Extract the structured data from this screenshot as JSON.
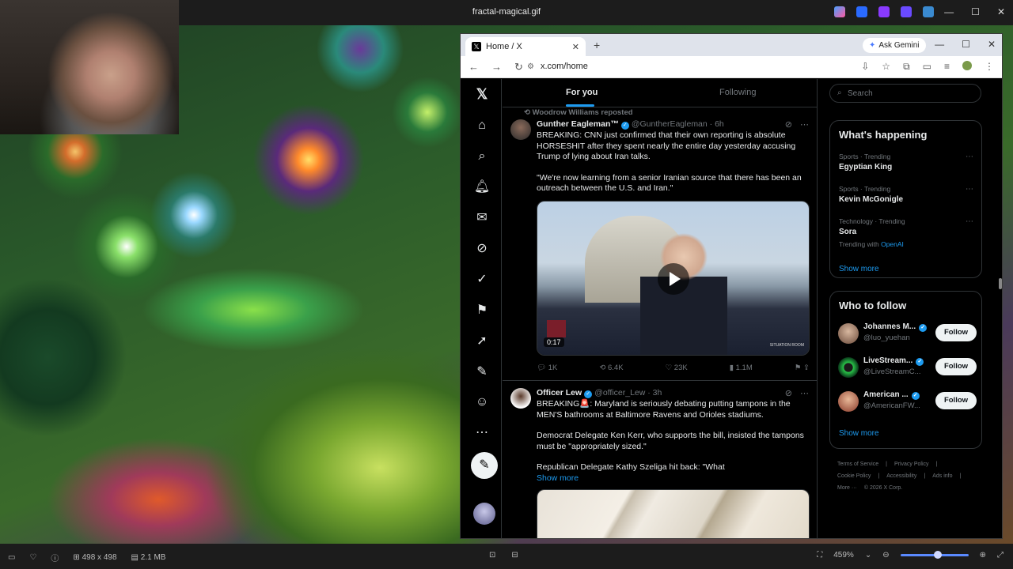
{
  "viewer": {
    "title": "fractal-magical.gif",
    "window_controls": [
      "—",
      "☐",
      "✕"
    ],
    "status": {
      "dimensions": "498 x 498",
      "size": "2.1 MB",
      "zoom": "459%"
    }
  },
  "browser": {
    "tab_title": "Home / X",
    "tab_close": "✕",
    "new_tab": "+",
    "gemini_label": "Ask Gemini",
    "url": "x.com/home",
    "window_controls": [
      "—",
      "☐",
      "✕"
    ]
  },
  "x": {
    "tabs": {
      "for_you": "For you",
      "following": "Following"
    },
    "posts": [
      {
        "repost_by": "Woodrow Williams reposted",
        "name": "Gunther Eagleman™",
        "handle": "@GuntherEagleman · 6h",
        "text": [
          "BREAKING: CNN just confirmed that their own reporting is absolute HORSESHIT after they spent nearly the entire day yesterday accusing Trump of lying about Iran talks.",
          "\"We're now learning from a senior Iranian source that there has been an outreach between the U.S. and Iran.\""
        ],
        "video_duration": "0:17",
        "video_caption": "SITUATION ROOM",
        "replies": "1K",
        "reposts": "6.4K",
        "likes": "23K",
        "views": "1.1M"
      },
      {
        "name": "Officer Lew",
        "handle": "@officer_Lew · 3h",
        "text": [
          "BREAKING🚨: Maryland is seriously debating putting tampons in the MEN'S bathrooms at Baltimore Ravens and Orioles stadiums.",
          "Democrat Delegate Ken Kerr, who supports the bill, insisted the tampons must be \"appropriately sized.\"",
          "Republican Delegate Kathy Szeliga hit back: \"What"
        ],
        "show_more": "Show more"
      }
    ],
    "search_placeholder": "Search",
    "happening": {
      "title": "What's happening",
      "trends": [
        {
          "meta": "Sports · Trending",
          "topic": "Egyptian King"
        },
        {
          "meta": "Sports · Trending",
          "topic": "Kevin McGonigle"
        },
        {
          "meta": "Technology · Trending",
          "topic": "Sora",
          "sub": "Trending with",
          "sub_link": "OpenAI"
        }
      ],
      "show_more": "Show more"
    },
    "who_to_follow": {
      "title": "Who to follow",
      "accounts": [
        {
          "name": "Johannes M...",
          "handle": "@luo_yuehan",
          "button": "Follow"
        },
        {
          "name": "LiveStream...",
          "handle": "@LiveStreamC...",
          "button": "Follow"
        },
        {
          "name": "American ...",
          "handle": "@AmericanFW...",
          "button": "Follow"
        }
      ],
      "show_more": "Show more"
    },
    "legal": [
      "Terms of Service",
      "|",
      "Privacy Policy",
      "|",
      "Cookie Policy",
      "|",
      "Accessibility",
      "|",
      "Ads info",
      "|",
      "More ···",
      "© 2026 X Corp."
    ]
  }
}
